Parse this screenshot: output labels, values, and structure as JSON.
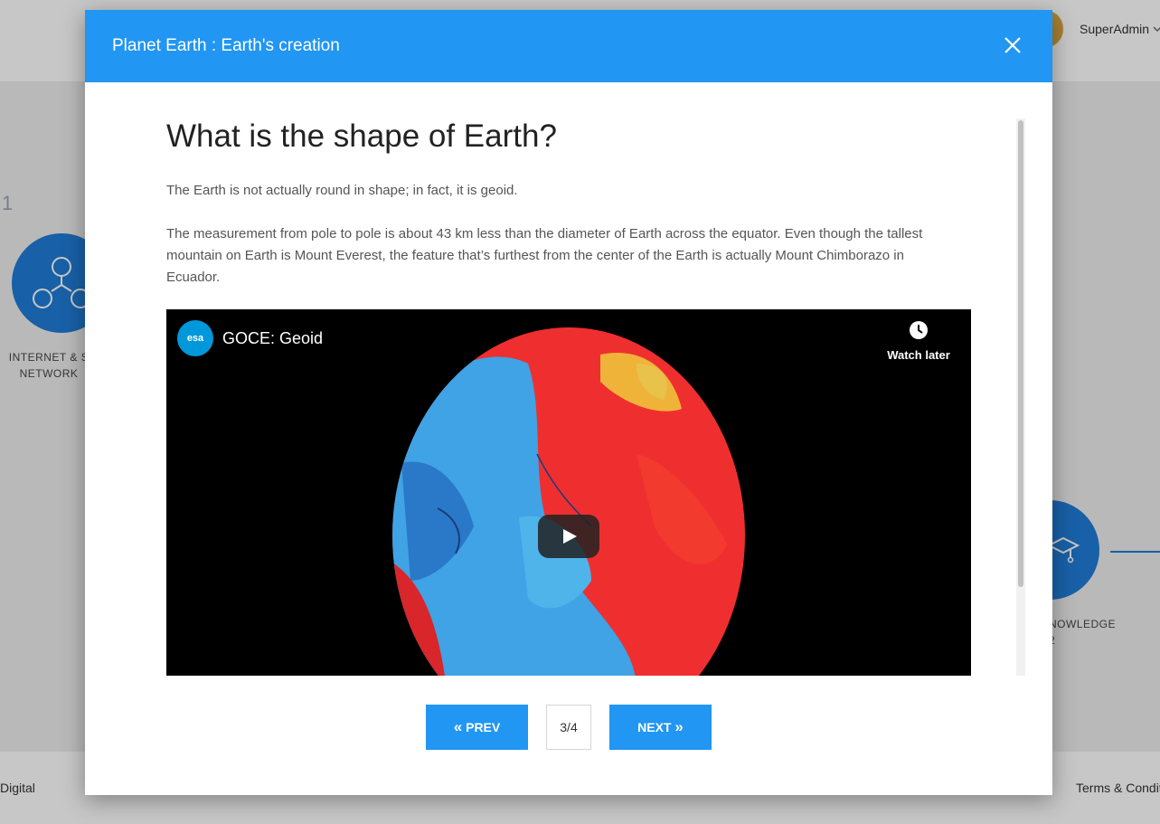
{
  "background": {
    "user_name": "SuperAdmin",
    "step_number": "1",
    "left_card_label": "INTERNET & S NETWORK",
    "right_card_label": "NOWLEDGE\n2",
    "footer_left": "Digital",
    "footer_right": "Terms & Condit"
  },
  "modal": {
    "title": "Planet Earth : Earth's creation",
    "heading": "What is the shape of Earth?",
    "paragraphs": [
      "The Earth is not actually round in shape; in fact, it is geoid.",
      "The measurement from pole to pole is about 43 km less than the diameter of Earth across the equator. Even though the tallest mountain on Earth is Mount Everest, the feature that’s furthest from the center of the Earth is actually Mount Chimborazo in Ecuador."
    ],
    "video": {
      "channel_logo_text": "esa",
      "title": "GOCE: Geoid",
      "watch_later_label": "Watch later"
    },
    "pager": {
      "prev_label": "PREV",
      "next_label": "NEXT",
      "indicator": "3/4"
    }
  },
  "colors": {
    "header_blue": "#2196f3",
    "button_blue": "#2196f3",
    "background_blue": "#1f7bd6"
  },
  "icons": [
    "close-icon",
    "clock-icon",
    "play-icon",
    "chevron-left-double-icon",
    "chevron-right-double-icon",
    "users-network-icon",
    "graduation-cap-icon",
    "chevron-down-icon"
  ]
}
